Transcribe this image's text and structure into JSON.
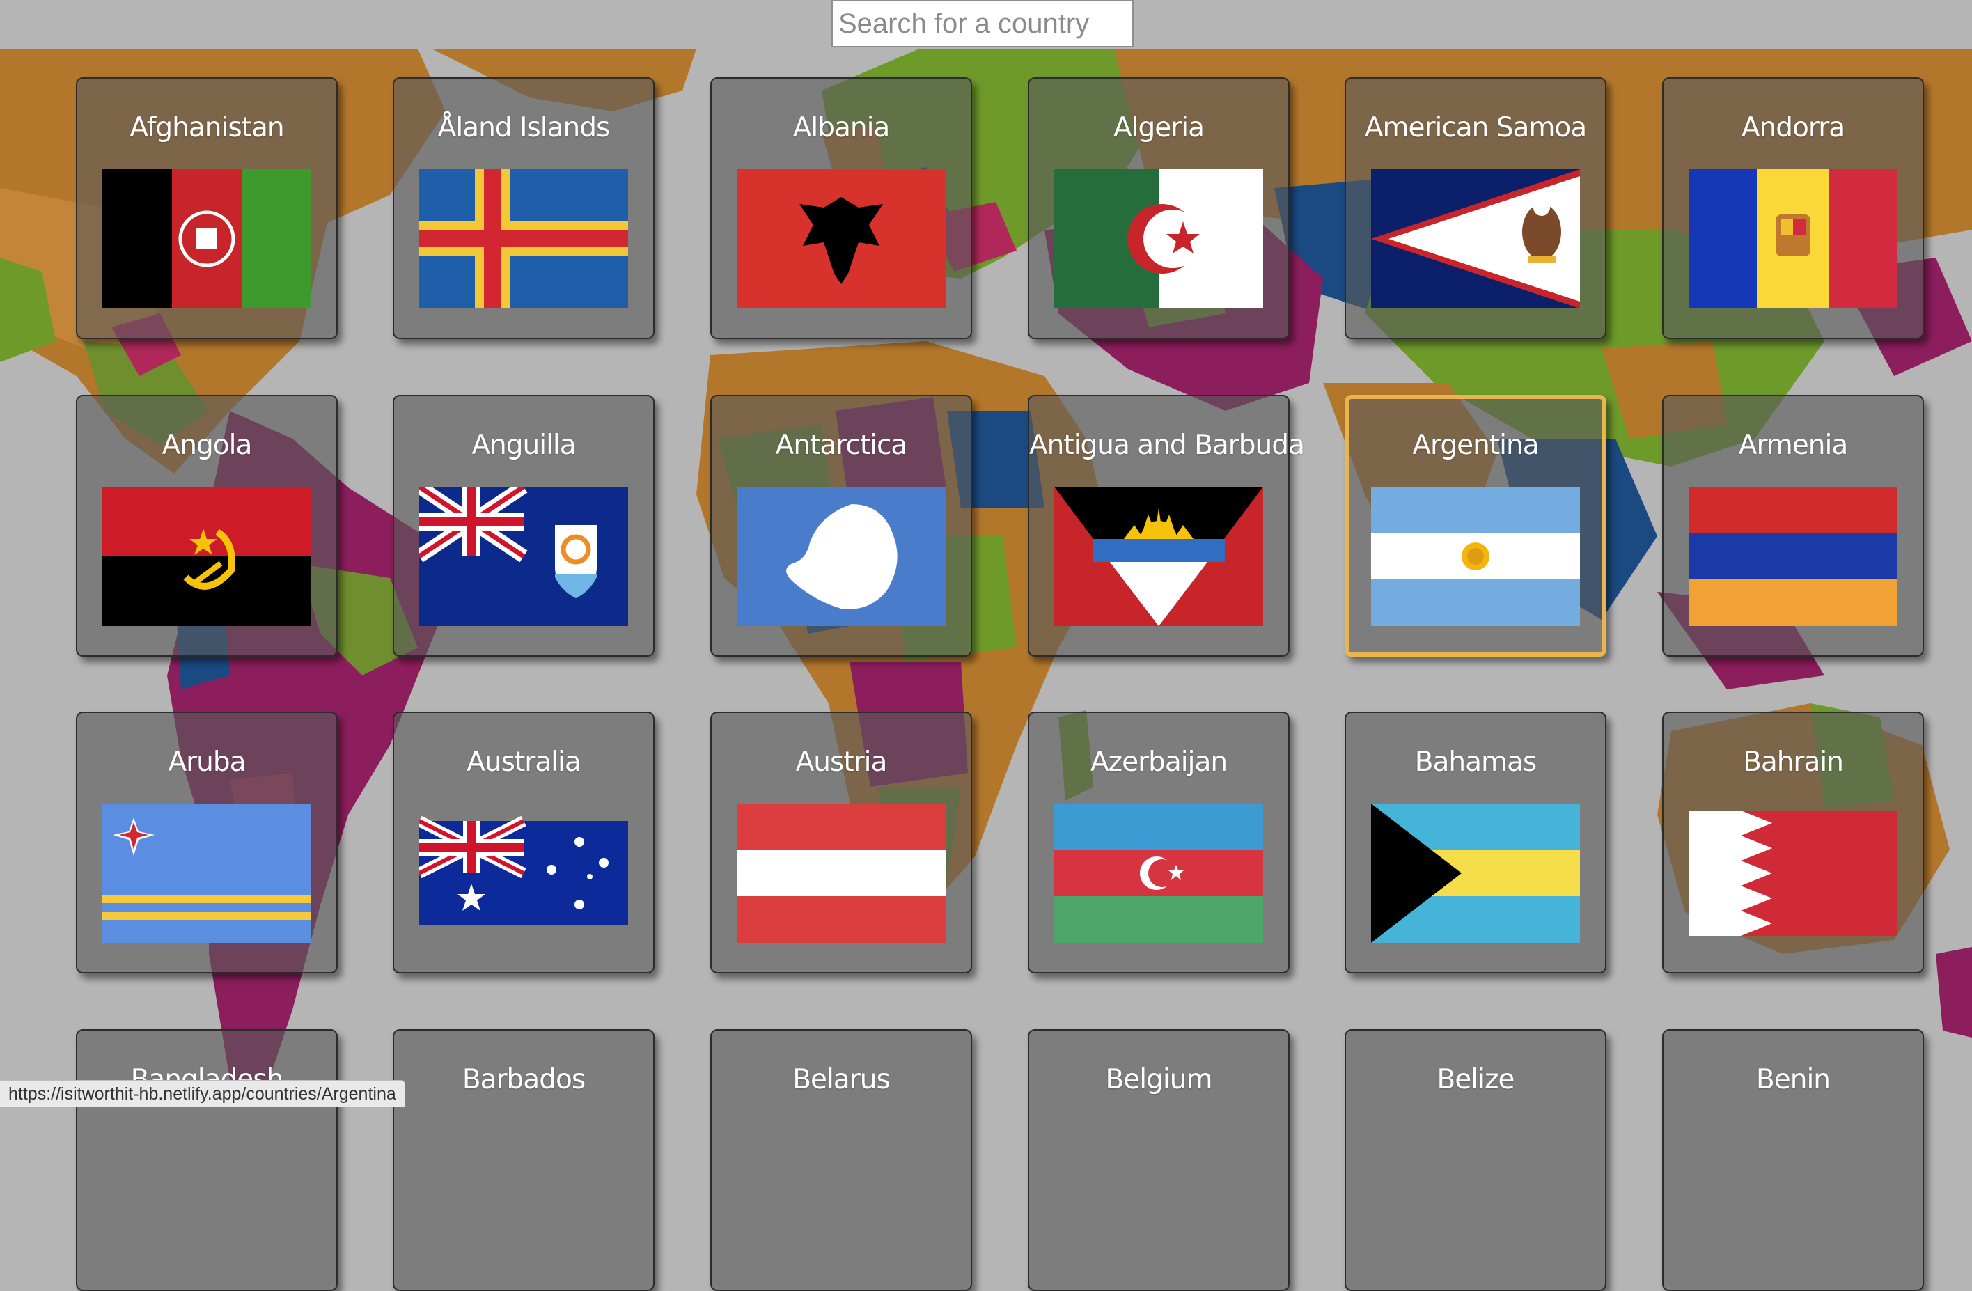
{
  "search": {
    "placeholder": "Search for a country",
    "value": ""
  },
  "status_url": "https://isitworthit-hb.netlify.app/countries/Argentina",
  "selected_country": "Argentina",
  "accent_color": "#e8b550",
  "countries": [
    {
      "name": "Afghanistan",
      "flag_icon": "afghanistan-flag-icon"
    },
    {
      "name": "Åland Islands",
      "flag_icon": "aland-islands-flag-icon"
    },
    {
      "name": "Albania",
      "flag_icon": "albania-flag-icon"
    },
    {
      "name": "Algeria",
      "flag_icon": "algeria-flag-icon"
    },
    {
      "name": "American Samoa",
      "flag_icon": "american-samoa-flag-icon"
    },
    {
      "name": "Andorra",
      "flag_icon": "andorra-flag-icon"
    },
    {
      "name": "Angola",
      "flag_icon": "angola-flag-icon"
    },
    {
      "name": "Anguilla",
      "flag_icon": "anguilla-flag-icon"
    },
    {
      "name": "Antarctica",
      "flag_icon": "antarctica-flag-icon"
    },
    {
      "name": "Antigua and Barbuda",
      "flag_icon": "antigua-and-barbuda-flag-icon"
    },
    {
      "name": "Argentina",
      "flag_icon": "argentina-flag-icon"
    },
    {
      "name": "Armenia",
      "flag_icon": "armenia-flag-icon"
    },
    {
      "name": "Aruba",
      "flag_icon": "aruba-flag-icon"
    },
    {
      "name": "Australia",
      "flag_icon": "australia-flag-icon"
    },
    {
      "name": "Austria",
      "flag_icon": "austria-flag-icon"
    },
    {
      "name": "Azerbaijan",
      "flag_icon": "azerbaijan-flag-icon"
    },
    {
      "name": "Bahamas",
      "flag_icon": "bahamas-flag-icon"
    },
    {
      "name": "Bahrain",
      "flag_icon": "bahrain-flag-icon"
    },
    {
      "name": "Bangladesh",
      "flag_icon": "bangladesh-flag-icon"
    },
    {
      "name": "Barbados",
      "flag_icon": "barbados-flag-icon"
    },
    {
      "name": "Belarus",
      "flag_icon": "belarus-flag-icon"
    },
    {
      "name": "Belgium",
      "flag_icon": "belgium-flag-icon"
    },
    {
      "name": "Belize",
      "flag_icon": "belize-flag-icon"
    },
    {
      "name": "Benin",
      "flag_icon": "benin-flag-icon"
    }
  ]
}
